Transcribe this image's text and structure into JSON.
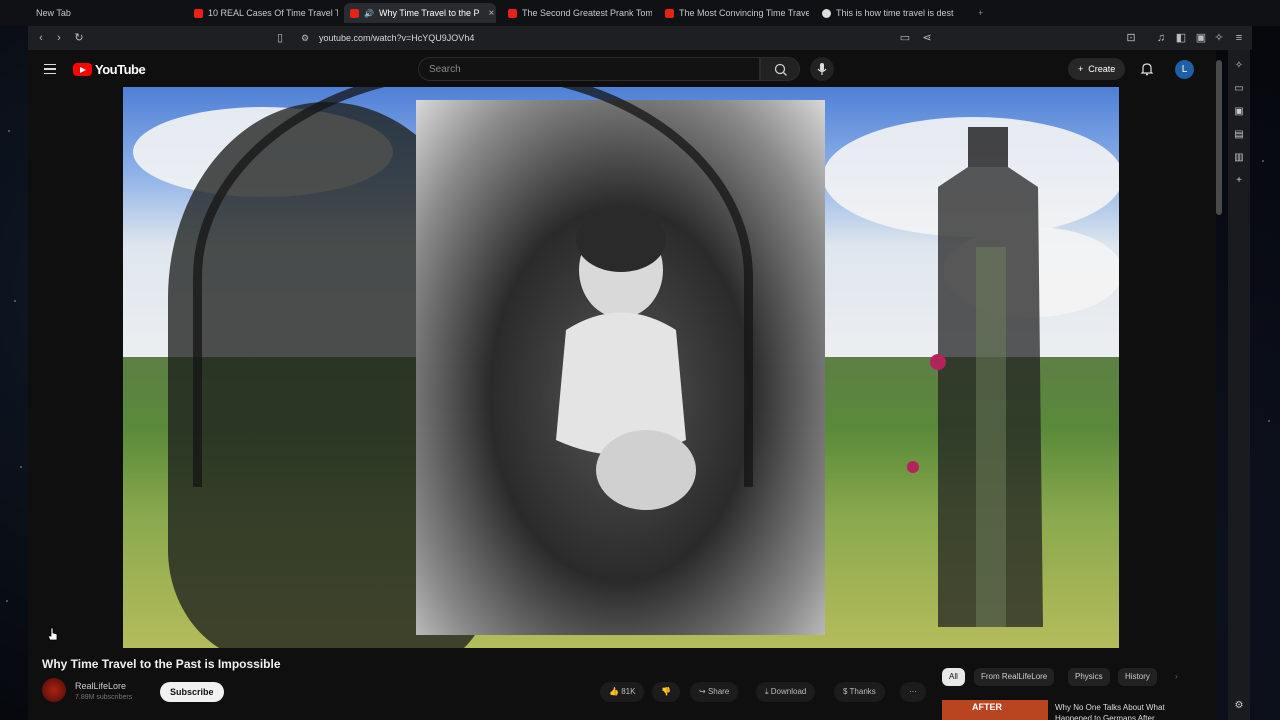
{
  "tabs": [
    {
      "label": "New Tab",
      "favicon": "none",
      "active": false
    },
    {
      "label": "10 REAL Cases Of Time Travel Th",
      "favicon": "youtube-icon",
      "active": false
    },
    {
      "label": "Why Time Travel to the P",
      "favicon": "youtube-icon",
      "active": true,
      "close": "×"
    },
    {
      "label": "The Second Greatest Prank Tom",
      "favicon": "youtube-icon",
      "active": false
    },
    {
      "label": "The Most Convincing Time Trave",
      "favicon": "youtube-icon",
      "active": false
    },
    {
      "label": "This is how time travel is dest",
      "favicon": "globe-icon",
      "active": false
    }
  ],
  "toolbar": {
    "url": "youtube.com/watch?v=HcYQU9JOVh4"
  },
  "youtube": {
    "logo_text": "YouTube",
    "search_placeholder": "Search",
    "create_label": "Create",
    "avatar_letter": "L"
  },
  "video": {
    "title": "Why Time Travel to the Past is Impossible",
    "channel_name": "RealLifeLore",
    "subscribers": "7.89M subscribers",
    "subscribe_label": "Subscribe",
    "likes": "81K",
    "share_label": "Share",
    "download_label": "Download",
    "thanks_label": "Thanks",
    "more_label": "···"
  },
  "sidebar_chips": [
    {
      "label": "All",
      "selected": true
    },
    {
      "label": "From RealLifeLore",
      "selected": false
    },
    {
      "label": "Physics",
      "selected": false
    },
    {
      "label": "History",
      "selected": false
    }
  ],
  "recommendation": {
    "thumb_text": "AFTER",
    "title": "Why No One Talks About What Happened to Germans After"
  },
  "colors": {
    "youtube_red": "#ff0000",
    "page_bg": "#0f0f0f",
    "avatar_blue": "#1e5fa8"
  }
}
